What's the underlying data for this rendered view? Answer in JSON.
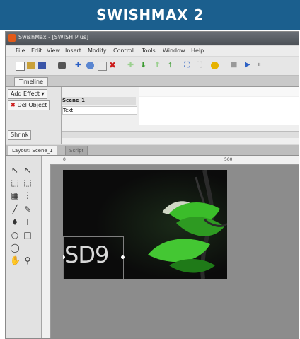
{
  "banner": {
    "title": "SWISHMAX 2"
  },
  "window": {
    "title": "SwishMax - [SWISH Plus]"
  },
  "menubar": {
    "items": [
      "File",
      "Edit",
      "View",
      "Insert",
      "Modify",
      "Control",
      "Tools",
      "Window",
      "Help"
    ]
  },
  "panels": {
    "timeline_tab": "Timeline"
  },
  "timeline": {
    "add_effect": "Add Effect",
    "del_object": "Del Object",
    "scene_label": "Scene_1",
    "track_label": "Text",
    "shrink_label": "Shrink"
  },
  "layout_tabs": {
    "active": "Layout: Scene_1",
    "inactive": "Script"
  },
  "ruler": {
    "mark_0": "0",
    "mark_500": "500"
  },
  "stage": {
    "text": "SD9"
  },
  "colors": {
    "banner": "#1b5f8e",
    "stage_bg": "#0b0b0b",
    "leaf_green": "#3bbd2a"
  }
}
